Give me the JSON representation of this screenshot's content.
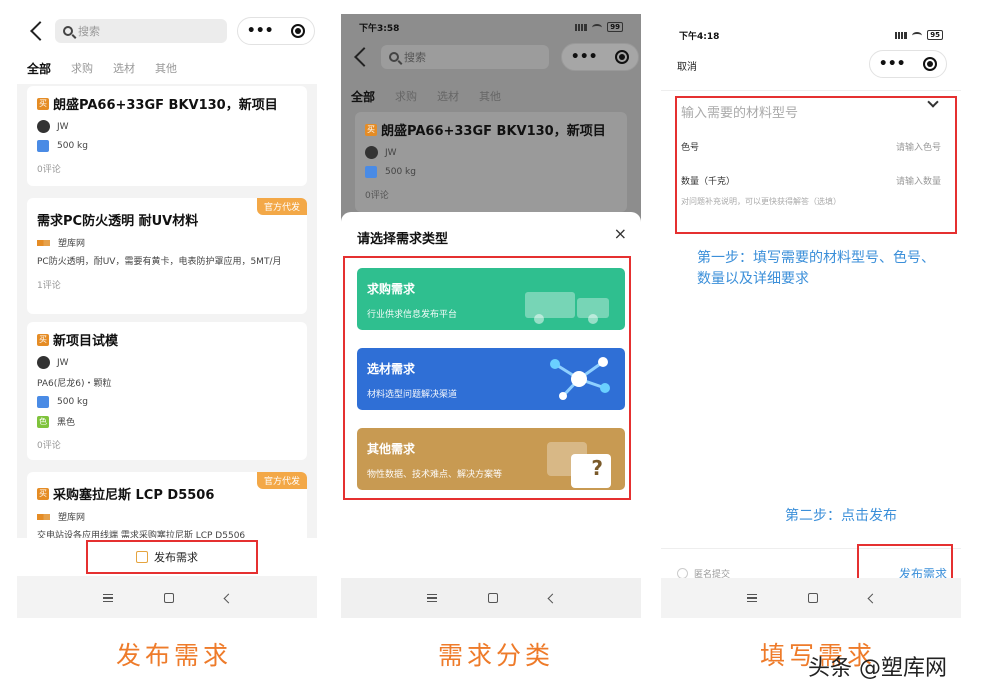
{
  "panel1": {
    "search_placeholder": "搜索",
    "tabs": [
      "全部",
      "求购",
      "选材",
      "其他"
    ],
    "cards": [
      {
        "badge": "买",
        "title": "朗盛PA66+33GF BKV130，新项目",
        "user": "JW",
        "qty": "500 kg",
        "comments": "0评论"
      },
      {
        "tag": "官方代发",
        "title": "需求PC防火透明 耐UV材料",
        "user": "塑库网",
        "desc": "PC防火透明，耐UV，需要有黄卡，电表防护罩应用，5MT/月",
        "comments": "1评论"
      },
      {
        "badge": "买",
        "title": "新项目试模",
        "user": "JW",
        "grade": "PA6(尼龙6)・颗粒",
        "qty": "500 kg",
        "color_badge": "色",
        "color": "黑色",
        "comments": "0评论"
      },
      {
        "badge": "买",
        "tag": "官方代发",
        "title": "采购塞拉尼斯 LCP D5506",
        "user": "塑库网",
        "desc": "交电站设各应用线端 需求采购塞拉尼斯 LCP D5506"
      }
    ],
    "publish_label": "发布需求"
  },
  "panel2": {
    "time": "下午3:58",
    "battery": "99",
    "search_placeholder": "搜索",
    "tabs": [
      "全部",
      "求购",
      "选材",
      "其他"
    ],
    "card": {
      "badge": "买",
      "title": "朗盛PA66+33GF BKV130，新项目",
      "user": "JW",
      "qty": "500 kg",
      "comments": "0评论"
    },
    "sheet_title": "请选择需求类型",
    "close": "×",
    "options": [
      {
        "title": "求购需求",
        "subtitle": "行业供求信息发布平台",
        "color": "#2fbf8f"
      },
      {
        "title": "选材需求",
        "subtitle": "材料选型问题解决渠道",
        "color": "#2f6fd6"
      },
      {
        "title": "其他需求",
        "subtitle": "物性数据、技术难点、解决方案等",
        "color": "#c89a52"
      }
    ],
    "question_mark": "?"
  },
  "panel3": {
    "time": "下午4:18",
    "battery": "95",
    "cancel": "取消",
    "material_placeholder": "输入需要的材料型号",
    "color_label": "色号",
    "color_placeholder": "请输入色号",
    "qty_label": "数量（千克）",
    "qty_placeholder": "请输入数量",
    "hint": "对问题补充说明，可以更快获得解答（选填）",
    "step1": "第一步：填写需要的材料型号、色号、数量以及详细要求",
    "step2": "第二步：点击发布",
    "anonymous": "匿名提交",
    "submit": "发布需求"
  },
  "captions": [
    "发布需求",
    "需求分类",
    "填写需求"
  ],
  "watermark": "头条 @塑库网",
  "colors": {
    "caption": "#ee7b2a",
    "highlight": "#e53030",
    "note": "#3b8fd9"
  }
}
